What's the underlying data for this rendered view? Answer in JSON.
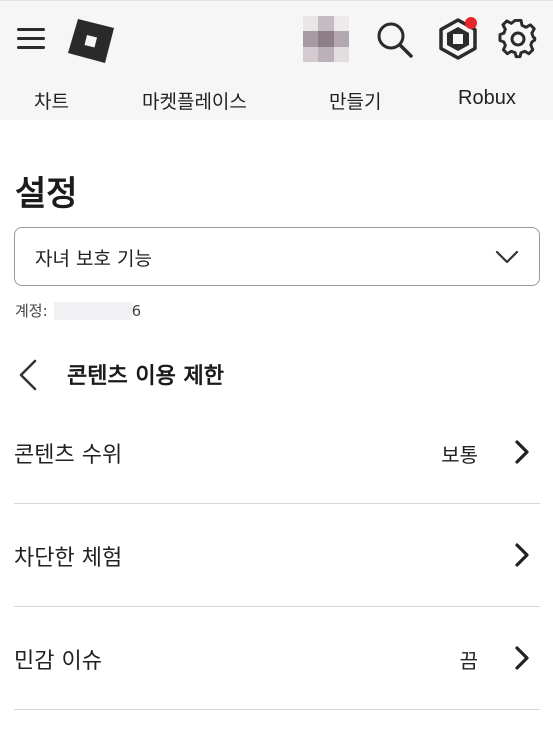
{
  "header": {
    "nav_tabs": [
      {
        "label": "차트"
      },
      {
        "label": "마켓플레이스"
      },
      {
        "label": "만들기"
      },
      {
        "label": "Robux"
      }
    ],
    "icons": [
      "menu-icon",
      "roblox-logo",
      "avatar",
      "search-icon",
      "robux-icon",
      "gear-icon"
    ],
    "notification_color": "#e5262b"
  },
  "page": {
    "title": "설정",
    "dropdown": {
      "selected": "자녀 보호 기능"
    },
    "account": {
      "label": "계정:",
      "suffix": "6"
    }
  },
  "section": {
    "title": "콘텐츠 이용 제한",
    "rows": [
      {
        "label": "콘텐츠 수위",
        "value": "보통"
      },
      {
        "label": "차단한 체험",
        "value": ""
      },
      {
        "label": "민감 이슈",
        "value": "끔"
      }
    ]
  }
}
